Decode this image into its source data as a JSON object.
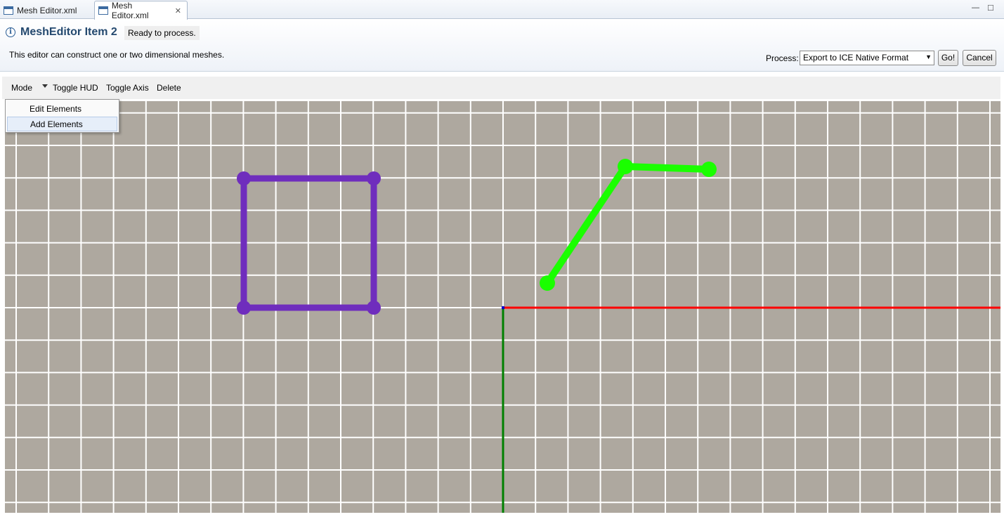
{
  "tabs": [
    {
      "label": "Mesh Editor.xml",
      "active": false
    },
    {
      "label": "Mesh Editor.xml",
      "active": true
    }
  ],
  "window_controls": {
    "minimize": "—",
    "maximize": "□"
  },
  "form": {
    "title": "MeshEditor Item 2",
    "status": "Ready to process.",
    "description": "This editor can construct one or two dimensional meshes.",
    "process_label": "Process:",
    "process_value": "Export to ICE Native Format",
    "go_label": "Go!",
    "cancel_label": "Cancel"
  },
  "toolbar": {
    "mode": "Mode",
    "toggle_hud": "Toggle HUD",
    "toggle_axis": "Toggle Axis",
    "delete": "Delete"
  },
  "mode_menu": {
    "items": [
      "Edit Elements",
      "Add Elements"
    ],
    "highlighted": "Add Elements"
  },
  "colors": {
    "canvas_bg": "#aea89f",
    "grid": "#ffffff",
    "x_axis": "#ff0000",
    "y_axis": "#008000",
    "square_element": "#6f2dbd",
    "polyline_element": "#1aff00"
  }
}
